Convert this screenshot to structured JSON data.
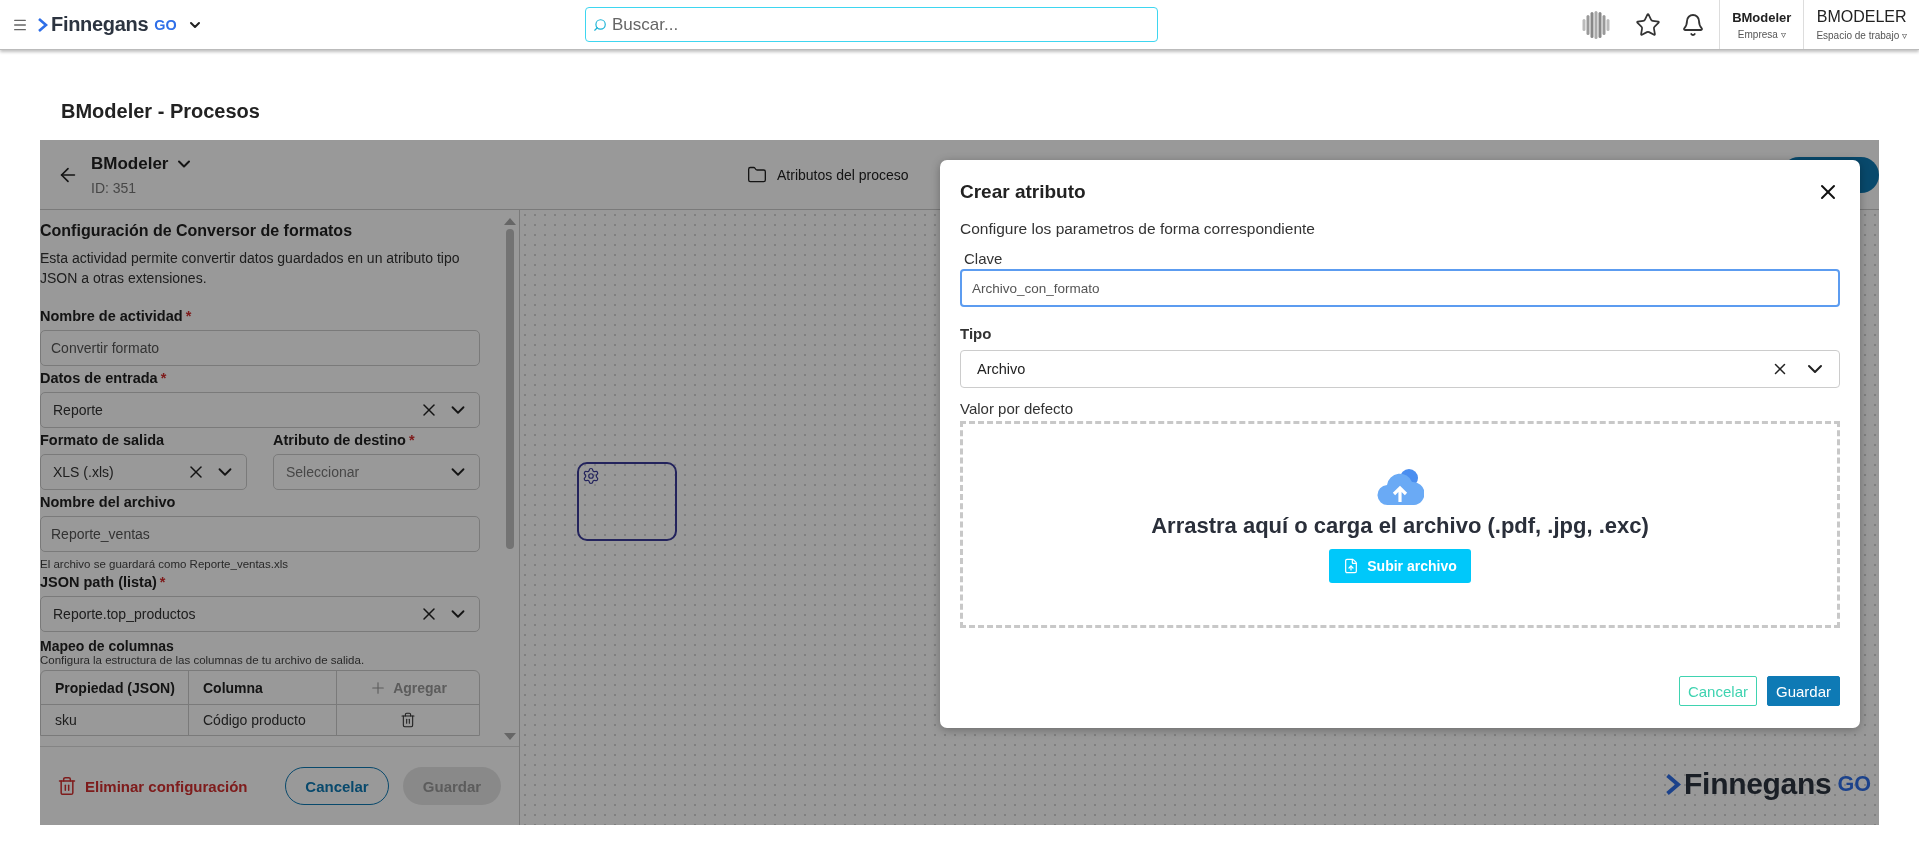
{
  "topbar": {
    "brand": {
      "name": "Finnegans",
      "suffix": "GO"
    },
    "search": {
      "placeholder": "Buscar..."
    },
    "orgs": [
      {
        "name": "BModeler",
        "label": "Empresa",
        "caret": "▿"
      },
      {
        "name": "BMODELER",
        "label": "Espacio de trabajo",
        "caret": "▿"
      }
    ]
  },
  "page_title": "BModeler - Procesos",
  "process": {
    "name": "BModeler",
    "id": "ID: 351",
    "attributes_button": "Atributos del proceso"
  },
  "config": {
    "title": "Configuración de Conversor de formatos",
    "description": "Esta actividad permite convertir datos guardados en un atributo tipo JSON a otras extensiones.",
    "required_mark": "*",
    "fields": [
      {
        "kind": "input",
        "label": "Nombre de actividad",
        "required": true,
        "value": "Convertir formato"
      },
      {
        "kind": "select",
        "label": "Datos de entrada",
        "required": true,
        "value": "Reporte",
        "clearable": true
      },
      {
        "kind": "pair",
        "fields": [
          {
            "kind": "select",
            "label": "Formato de salida",
            "required": false,
            "value": "XLS (.xls)",
            "clearable": true
          },
          {
            "kind": "select",
            "label": "Atributo de destino",
            "required": true,
            "placeholder": "Seleccionar",
            "clearable": false
          }
        ]
      },
      {
        "kind": "input",
        "label": "Nombre del archivo",
        "required": false,
        "value": "Reporte_ventas",
        "hint": "El archivo se guardará como Reporte_ventas.xls"
      },
      {
        "kind": "select",
        "label": "JSON path (lista)",
        "required": true,
        "value": "Reporte.top_productos",
        "clearable": true
      }
    ],
    "mapping": {
      "title": "Mapeo de columnas",
      "description": "Configura la estructura de las columnas de tu archivo de salida.",
      "columns": [
        "Propiedad (JSON)",
        "Columna"
      ],
      "add_button": "Agregar",
      "rows": [
        {
          "property": "sku",
          "column": "Código producto"
        }
      ]
    },
    "footer": {
      "delete": "Eliminar configuración",
      "cancel": "Cancelar",
      "save": {
        "label": "Guardar",
        "disabled": true
      }
    }
  },
  "canvas": {
    "brand": {
      "name": "Finnegans",
      "suffix": "GO"
    }
  },
  "modal": {
    "title": "Crear atributo",
    "subtitle": "Configure los parametros de forma correspondiente",
    "key": {
      "label": "Clave",
      "value": "Archivo_con_formato",
      "focused": true
    },
    "type": {
      "label": "Tipo",
      "value": "Archivo"
    },
    "default": {
      "label": "Valor por defecto",
      "dropzone_text": "Arrastra aquí o carga el archivo (.pdf, .jpg, .exc)",
      "upload_button": "Subir archivo"
    },
    "buttons": {
      "cancel": "Cancelar",
      "save": "Guardar"
    }
  }
}
